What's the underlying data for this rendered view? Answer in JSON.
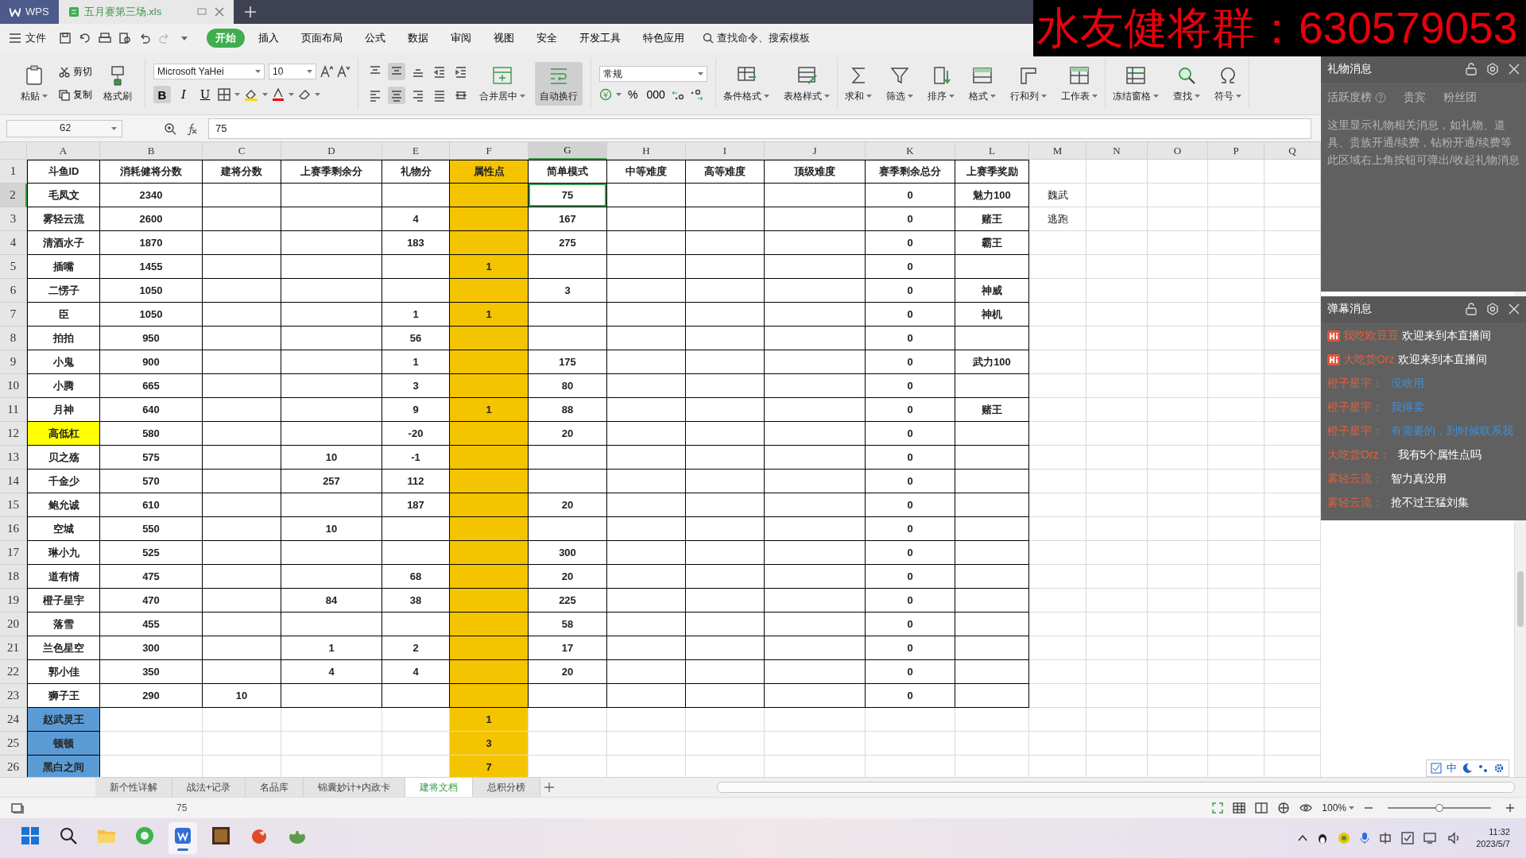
{
  "window_tabs": [
    {
      "label": "WPS",
      "kind": "app",
      "selected": false
    },
    {
      "label": "五月赛第三场.xls",
      "kind": "document",
      "selected": true
    }
  ],
  "menu": {
    "file": "文件",
    "tabs": [
      {
        "label": "开始",
        "selected": true
      },
      {
        "label": "插入",
        "selected": false
      },
      {
        "label": "页面布局",
        "selected": false
      },
      {
        "label": "公式",
        "selected": false
      },
      {
        "label": "数据",
        "selected": false
      },
      {
        "label": "审阅",
        "selected": false
      },
      {
        "label": "视图",
        "selected": false
      },
      {
        "label": "安全",
        "selected": false
      },
      {
        "label": "开发工具",
        "selected": false
      },
      {
        "label": "特色应用",
        "selected": false
      }
    ],
    "search": "查找命令、搜索模板"
  },
  "ribbon": {
    "clipboard": [
      "粘贴",
      "剪切",
      "复制",
      "格式刷"
    ],
    "font_family": "Microsoft YaHei",
    "font_size": "10",
    "format_buttons": [
      {
        "label": "B",
        "selected": true
      },
      {
        "label": "I",
        "selected": false
      },
      {
        "label": "U",
        "selected": false
      }
    ],
    "align_buttons": [
      {
        "selected": false
      },
      {
        "selected": true
      },
      {
        "selected": false
      },
      {
        "selected": false
      },
      {
        "selected": false
      },
      {
        "selected": false
      },
      {
        "selected": true
      },
      {
        "selected": false
      },
      {
        "selected": false
      },
      {
        "selected": false
      }
    ],
    "merge": {
      "label": "合并居中",
      "selected": false
    },
    "wrap": {
      "label": "自动换行",
      "selected": true
    },
    "number_format": "常规",
    "number_buttons": [
      "%",
      "000"
    ],
    "tools": [
      "条件格式",
      "表格样式",
      "求和",
      "筛选",
      "排序",
      "格式",
      "行和列",
      "工作表",
      "冻结窗格",
      "查找",
      "符号"
    ]
  },
  "formula_bar": {
    "cell": "G2",
    "value": "75"
  },
  "sheet": {
    "columns": [
      {
        "letter": "A",
        "selected": false
      },
      {
        "letter": "B",
        "selected": false
      },
      {
        "letter": "C",
        "selected": false
      },
      {
        "letter": "D",
        "selected": false
      },
      {
        "letter": "E",
        "selected": false
      },
      {
        "letter": "F",
        "selected": false,
        "color": "#f5c400"
      },
      {
        "letter": "G",
        "selected": true
      },
      {
        "letter": "H",
        "selected": false
      },
      {
        "letter": "I",
        "selected": false
      },
      {
        "letter": "J",
        "selected": false
      },
      {
        "letter": "K",
        "selected": false
      },
      {
        "letter": "L",
        "selected": false
      },
      {
        "letter": "M",
        "selected": false
      },
      {
        "letter": "N",
        "selected": false
      },
      {
        "letter": "O",
        "selected": false
      },
      {
        "letter": "P",
        "selected": false
      },
      {
        "letter": "Q",
        "selected": false
      }
    ],
    "rows": [
      {
        "number": "1",
        "selected": false,
        "bordered": true,
        "cells": {
          "A": "斗鱼ID",
          "B": "消耗健将分数",
          "C": "建将分数",
          "D": "上赛季剩余分",
          "E": "礼物分",
          "F": "属性点",
          "G": "简单模式",
          "H": "中等难度",
          "I": "高等难度",
          "J": "顶级难度",
          "K": "赛季剩余总分",
          "L": "上赛季奖励"
        }
      },
      {
        "number": "2",
        "selected": true,
        "bordered": true,
        "cells": {
          "A": "毛凤文",
          "B": "2340",
          "G": "75",
          "K": "0",
          "L": "魅力100",
          "M": "魏武"
        }
      },
      {
        "number": "3",
        "selected": false,
        "bordered": true,
        "cells": {
          "A": "雾轻云流",
          "B": "2600",
          "E": "4",
          "G": "167",
          "K": "0",
          "L": "赌王",
          "M": "逃跑"
        }
      },
      {
        "number": "4",
        "selected": false,
        "bordered": true,
        "cells": {
          "A": "清酒水子",
          "B": "1870",
          "E": "183",
          "G": "275",
          "K": "0",
          "L": "霸王"
        }
      },
      {
        "number": "5",
        "selected": false,
        "bordered": true,
        "cells": {
          "A": "插嘴",
          "B": "1455",
          "F": "1",
          "K": "0"
        }
      },
      {
        "number": "6",
        "selected": false,
        "bordered": true,
        "cells": {
          "A": "二愣子",
          "B": "1050",
          "G": "3",
          "K": "0",
          "L": "神威"
        }
      },
      {
        "number": "7",
        "selected": false,
        "bordered": true,
        "cells": {
          "A": "臣",
          "B": "1050",
          "E": "1",
          "F": "1",
          "K": "0",
          "L": "神机"
        }
      },
      {
        "number": "8",
        "selected": false,
        "bordered": true,
        "cells": {
          "A": "拍拍",
          "B": "950",
          "E": "56",
          "K": "0"
        }
      },
      {
        "number": "9",
        "selected": false,
        "bordered": true,
        "cells": {
          "A": "小鬼",
          "B": "900",
          "E": "1",
          "G": "175",
          "K": "0",
          "L": "武力100"
        }
      },
      {
        "number": "10",
        "selected": false,
        "bordered": true,
        "cells": {
          "A": "小腾",
          "B": "665",
          "E": "3",
          "G": "80",
          "K": "0"
        }
      },
      {
        "number": "11",
        "selected": false,
        "bordered": true,
        "cells": {
          "A": "月神",
          "B": "640",
          "E": "9",
          "F": "1",
          "G": "88",
          "K": "0",
          "L": "赌王"
        }
      },
      {
        "number": "12",
        "selected": false,
        "bordered": true,
        "color": "#ffff00",
        "cells": {
          "A": "高低杠",
          "B": "580",
          "E": "-20",
          "G": "20",
          "K": "0"
        }
      },
      {
        "number": "13",
        "selected": false,
        "bordered": true,
        "cells": {
          "A": "贝之殇",
          "B": "575",
          "D": "10",
          "E": "-1",
          "K": "0"
        }
      },
      {
        "number": "14",
        "selected": false,
        "bordered": true,
        "cells": {
          "A": "千金少",
          "B": "570",
          "D": "257",
          "E": "112",
          "K": "0"
        }
      },
      {
        "number": "15",
        "selected": false,
        "bordered": true,
        "cells": {
          "A": "鲍允诚",
          "B": "610",
          "E": "187",
          "G": "20",
          "K": "0"
        }
      },
      {
        "number": "16",
        "selected": false,
        "bordered": true,
        "cells": {
          "A": "空城",
          "B": "550",
          "D": "10",
          "K": "0"
        }
      },
      {
        "number": "17",
        "selected": false,
        "bordered": true,
        "cells": {
          "A": "琳小九",
          "B": "525",
          "G": "300",
          "K": "0"
        }
      },
      {
        "number": "18",
        "selected": false,
        "bordered": true,
        "cells": {
          "A": "道有情",
          "B": "475",
          "E": "68",
          "G": "20",
          "K": "0"
        }
      },
      {
        "number": "19",
        "selected": false,
        "bordered": true,
        "cells": {
          "A": "橙子星宇",
          "B": "470",
          "D": "84",
          "E": "38",
          "G": "225",
          "K": "0"
        }
      },
      {
        "number": "20",
        "selected": false,
        "bordered": true,
        "cells": {
          "A": "落雪",
          "B": "455",
          "G": "58",
          "K": "0"
        }
      },
      {
        "number": "21",
        "selected": false,
        "bordered": true,
        "cells": {
          "A": "兰色星空",
          "B": "300",
          "D": "1",
          "E": "2",
          "G": "17",
          "K": "0"
        }
      },
      {
        "number": "22",
        "selected": false,
        "bordered": true,
        "cells": {
          "A": "郭小佳",
          "B": "350",
          "D": "4",
          "E": "4",
          "G": "20",
          "K": "0"
        }
      },
      {
        "number": "23",
        "selected": false,
        "bordered": true,
        "cells": {
          "A": "狮子王",
          "B": "290",
          "C": "10",
          "K": "0"
        }
      },
      {
        "number": "24",
        "selected": false,
        "bordered": false,
        "color": "#5b9bd5",
        "cells": {
          "A": "赵武灵王",
          "F": "1"
        }
      },
      {
        "number": "25",
        "selected": false,
        "bordered": false,
        "color": "#5b9bd5",
        "cells": {
          "A": "顿顿",
          "F": "3"
        }
      },
      {
        "number": "26",
        "selected": false,
        "bordered": false,
        "color": "#5b9bd5",
        "cells": {
          "A": "黑白之间",
          "F": "7"
        }
      }
    ]
  },
  "sheet_tabs": [
    {
      "label": "新个性详解",
      "selected": false
    },
    {
      "label": "战法+记录",
      "selected": false
    },
    {
      "label": "名品库",
      "selected": false
    },
    {
      "label": "锦囊妙计+内政卡",
      "selected": false
    },
    {
      "label": "建将文档",
      "selected": true
    },
    {
      "label": "总积分榜",
      "selected": false
    }
  ],
  "status_bar": {
    "value": "75",
    "zoom": "100%",
    "zoom_slider": {
      "level": 0.5
    }
  },
  "ime_bar": {
    "mode": "中"
  },
  "banner": {
    "text": "水友健将群：630579053"
  },
  "gift_panel": {
    "title": "礼物消息",
    "tabs": [
      "活跃度榜",
      "贵宾",
      "粉丝团"
    ],
    "notice": "这里显示礼物相关消息，如礼物、道具、贵族开通/续费，钻粉开通/续费等此区域右上角按钮可弹出/收起礼物消息"
  },
  "chat_panel": {
    "title": "弹幕消息",
    "messages": [
      {
        "kind": "welcome",
        "user": "我吃欧豆豆",
        "text": "欢迎来到本直播间",
        "color": "#ffffff"
      },
      {
        "kind": "welcome",
        "user": "大吃货Orz",
        "text": "欢迎来到本直播间",
        "color": "#ffffff"
      },
      {
        "kind": "chat",
        "user": "橙子星宇：",
        "text": "没啥用",
        "color": "#3f8fd8"
      },
      {
        "kind": "chat",
        "user": "橙子星宇：",
        "text": "我得卖",
        "color": "#3f8fd8"
      },
      {
        "kind": "chat",
        "user": "橙子星宇：",
        "text": "有需要的，到时候联系我",
        "color": "#3f8fd8"
      },
      {
        "kind": "chat",
        "user": "大吃货Orz：",
        "text": "我有5个属性点吗",
        "color": "#ffffff"
      },
      {
        "kind": "chat",
        "user": "雾轻云流：",
        "text": "智力真没用",
        "color": "#ffffff"
      },
      {
        "kind": "chat",
        "user": "雾轻云流：",
        "text": "抢不过王猛刘集",
        "color": "#ffffff"
      }
    ]
  },
  "taskbar": {
    "apps": [
      {
        "selected": false
      },
      {
        "selected": false
      },
      {
        "selected": false
      },
      {
        "selected": false
      },
      {
        "selected": true
      },
      {
        "selected": false
      },
      {
        "selected": false
      },
      {
        "selected": false
      }
    ],
    "time": "11:32",
    "date": "2023/5/7"
  }
}
